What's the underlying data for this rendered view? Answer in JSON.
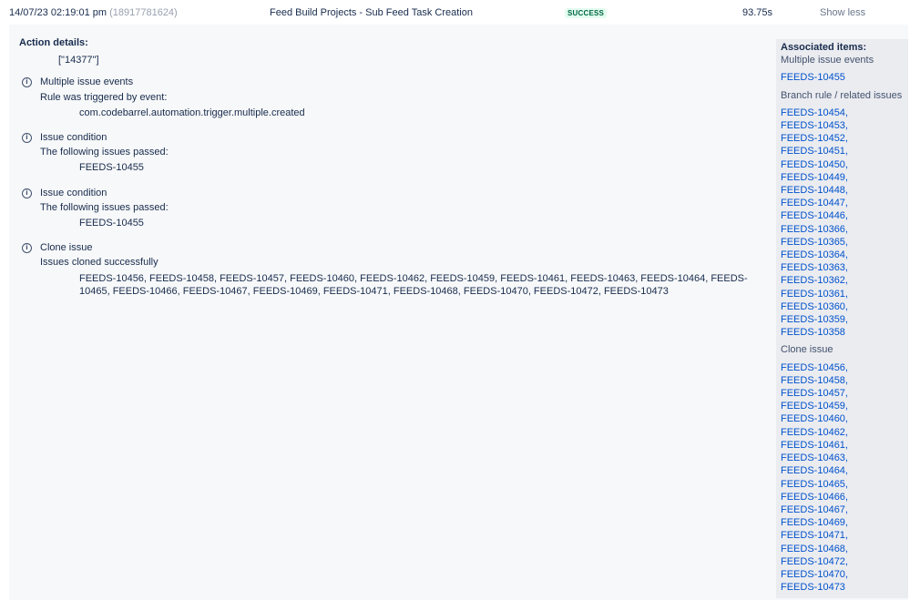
{
  "header": {
    "timestamp": "14/07/23 02:19:01 pm",
    "audit_id": "(18917781624)",
    "title": "Feed Build Projects - Sub Feed Task Creation",
    "status": "SUCCESS",
    "duration": "93.75s",
    "toggle_label": "Show less",
    "status_color": "#006644"
  },
  "details": {
    "title": "Action details:",
    "context": "[\"14377\"]",
    "entries": [
      {
        "icon": "info-icon",
        "title": "Multiple issue events",
        "subtitle": "Rule was triggered by event:",
        "value": "com.codebarrel.automation.trigger.multiple.created"
      },
      {
        "icon": "info-icon",
        "title": "Issue condition",
        "subtitle": "The following issues passed:",
        "value": "FEEDS-10455"
      },
      {
        "icon": "info-icon",
        "title": "Issue condition",
        "subtitle": "The following issues passed:",
        "value": "FEEDS-10455"
      },
      {
        "icon": "info-icon",
        "title": "Clone issue",
        "subtitle": "Issues cloned successfully",
        "value": "FEEDS-10456, FEEDS-10458, FEEDS-10457, FEEDS-10460, FEEDS-10462, FEEDS-10459, FEEDS-10461, FEEDS-10463, FEEDS-10464, FEEDS-10465, FEEDS-10466, FEEDS-10467, FEEDS-10469, FEEDS-10471, FEEDS-10468, FEEDS-10470, FEEDS-10472, FEEDS-10473"
      }
    ]
  },
  "sidebar": {
    "title": "Associated items:",
    "group1_label": "Multiple issue events",
    "group1_link": "FEEDS-10455",
    "group2_label": "Branch rule / related issues",
    "group2_links": [
      "FEEDS-10454,",
      "FEEDS-10453,",
      "FEEDS-10452,",
      "FEEDS-10451,",
      "FEEDS-10450,",
      "FEEDS-10449,",
      "FEEDS-10448,",
      "FEEDS-10447,",
      "FEEDS-10446,",
      "FEEDS-10366,",
      "FEEDS-10365,",
      "FEEDS-10364,",
      "FEEDS-10363,",
      "FEEDS-10362,",
      "FEEDS-10361,",
      "FEEDS-10360,",
      "FEEDS-10359,",
      "FEEDS-10358"
    ],
    "group3_label": "Clone issue",
    "group3_links": [
      "FEEDS-10456,",
      "FEEDS-10458,",
      "FEEDS-10457,",
      "FEEDS-10459,",
      "FEEDS-10460,",
      "FEEDS-10462,",
      "FEEDS-10461,",
      "FEEDS-10463,",
      "FEEDS-10464,",
      "FEEDS-10465,",
      "FEEDS-10466,",
      "FEEDS-10467,",
      "FEEDS-10469,",
      "FEEDS-10471,",
      "FEEDS-10468,",
      "FEEDS-10472,",
      "FEEDS-10470,",
      "FEEDS-10473"
    ],
    "link_color": "#0052cc"
  }
}
